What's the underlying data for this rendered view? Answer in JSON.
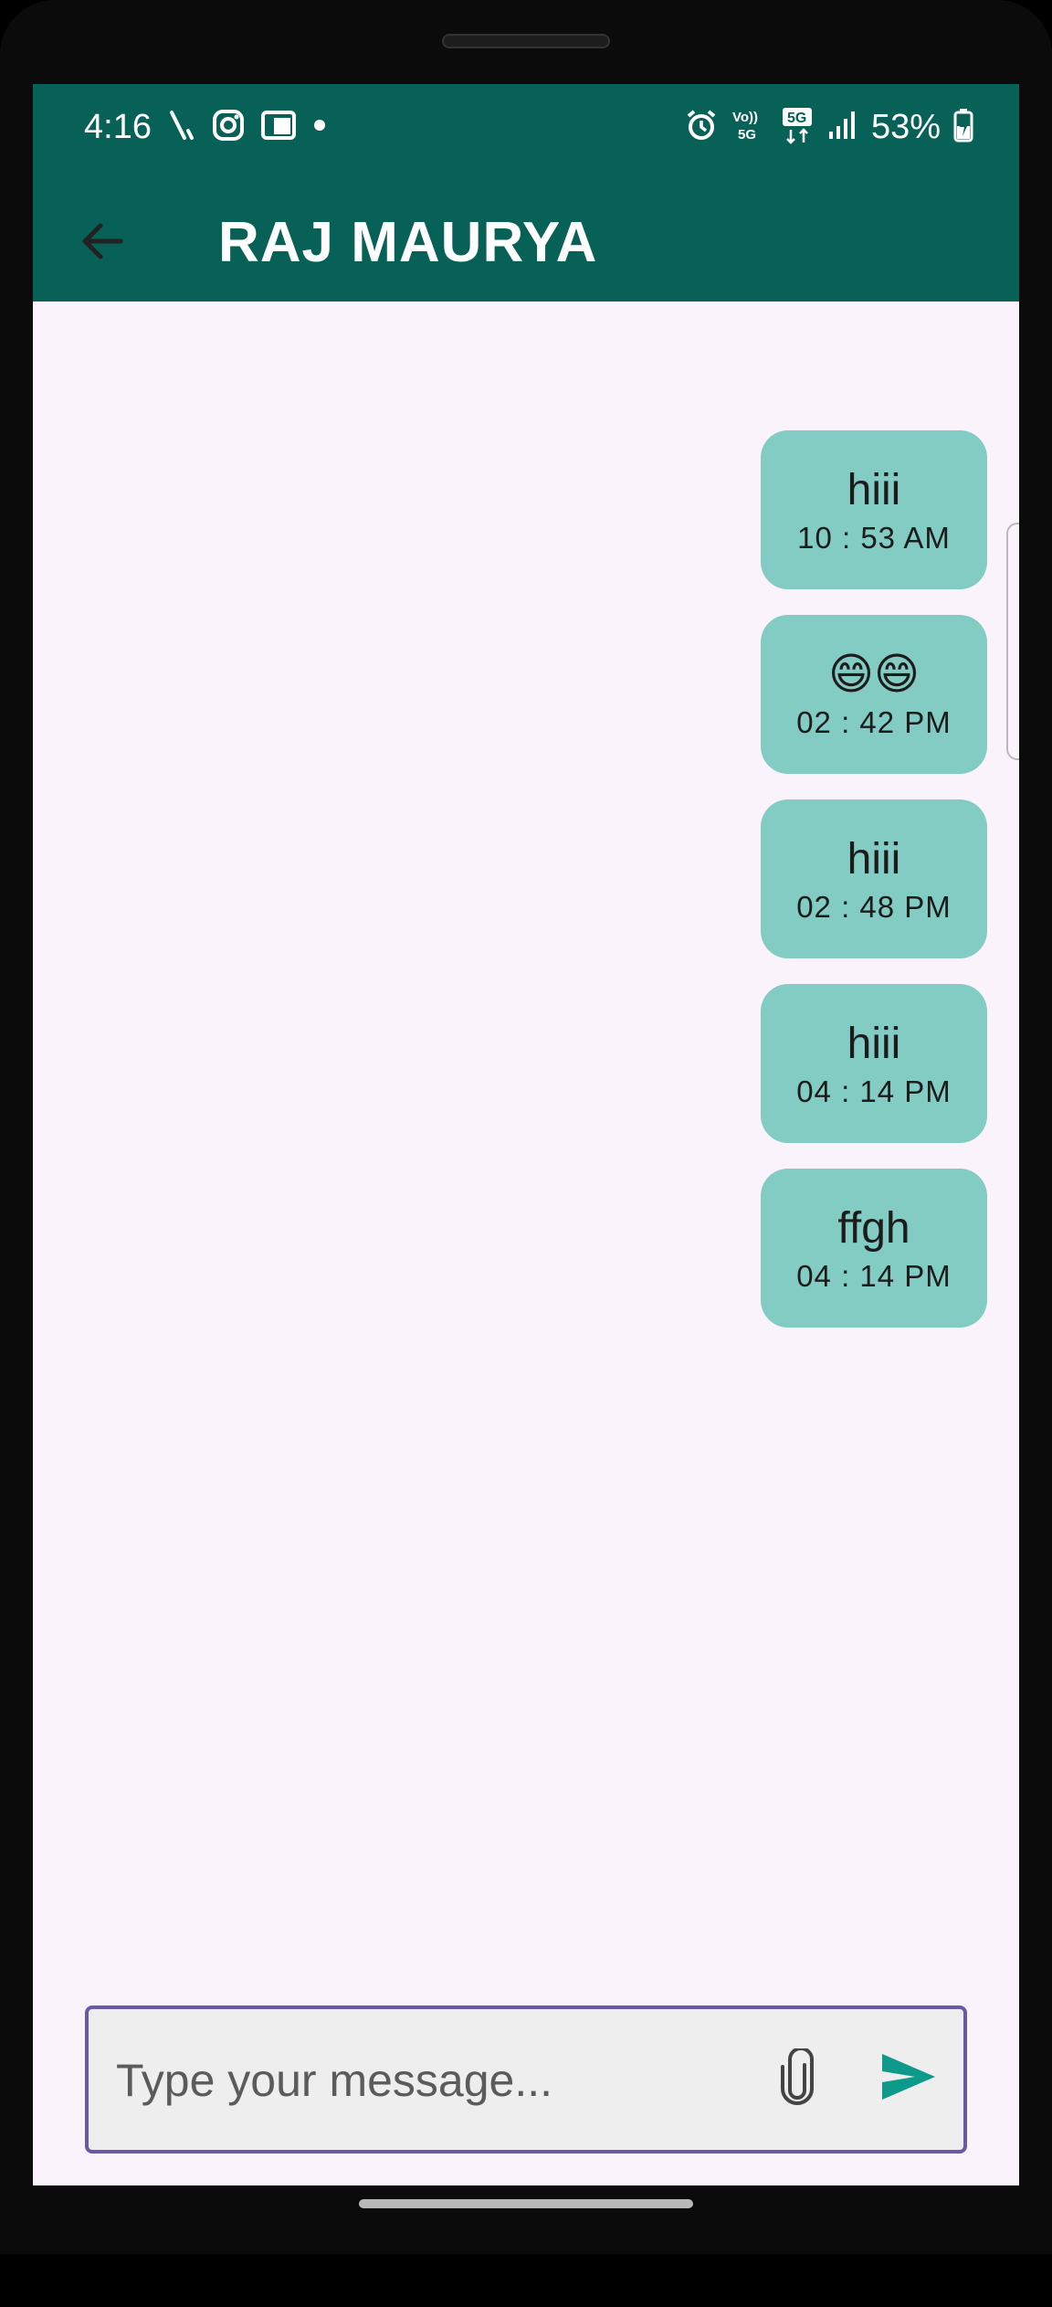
{
  "status_bar": {
    "time": "4:16",
    "battery": "53%",
    "network_label": "5G",
    "volte_label": "Vo)) 5G",
    "left_icons": [
      "missed-call-icon",
      "instagram-icon",
      "card-icon",
      "dot-icon"
    ],
    "right_icons": [
      "alarm-icon",
      "volte-icon",
      "5g-icon",
      "signal-icon",
      "battery-charging-icon"
    ]
  },
  "app_bar": {
    "title": "RAJ MAURYA",
    "back_icon": "arrow-back-icon",
    "color": "#076157"
  },
  "messages": [
    {
      "text": "hiii",
      "time": "10 : 53 AM"
    },
    {
      "text": "😄😄",
      "time": "02 : 42 PM"
    },
    {
      "text": "hiii",
      "time": "02 : 48 PM"
    },
    {
      "text": "hiii",
      "time": "04 : 14 PM"
    },
    {
      "text": "ffgh",
      "time": "04 : 14 PM"
    }
  ],
  "composer": {
    "placeholder": "Type your message...",
    "attach_icon": "paperclip-icon",
    "send_icon": "send-icon",
    "send_color": "#0d9a8a",
    "border_color": "#6a5aa6"
  },
  "colors": {
    "bubble": "#83ccc3",
    "background": "#fbf3fc"
  }
}
